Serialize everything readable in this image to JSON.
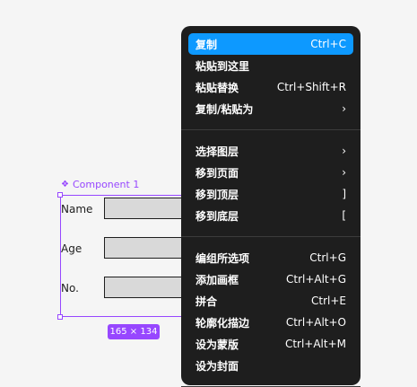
{
  "canvas": {
    "component_label": "Component 1",
    "rows": [
      {
        "label": "Name"
      },
      {
        "label": "Age"
      },
      {
        "label": "No."
      }
    ],
    "size_badge": "165 × 134"
  },
  "context_menu": {
    "groups": [
      [
        {
          "label": "复制",
          "shortcut": "Ctrl+C",
          "active": true
        },
        {
          "label": "粘贴到这里",
          "shortcut": ""
        },
        {
          "label": "粘贴替换",
          "shortcut": "Ctrl+Shift+R"
        },
        {
          "label": "复制/粘贴为",
          "shortcut": "›"
        }
      ],
      [
        {
          "label": "选择图层",
          "shortcut": "›"
        },
        {
          "label": "移到页面",
          "shortcut": "›"
        },
        {
          "label": "移到顶层",
          "shortcut": "]"
        },
        {
          "label": "移到底层",
          "shortcut": "["
        }
      ],
      [
        {
          "label": "编组所选项",
          "shortcut": "Ctrl+G"
        },
        {
          "label": "添加画框",
          "shortcut": "Ctrl+Alt+G"
        },
        {
          "label": "拼合",
          "shortcut": "Ctrl+E"
        },
        {
          "label": "轮廓化描边",
          "shortcut": "Ctrl+Alt+O"
        },
        {
          "label": "设为蒙版",
          "shortcut": "Ctrl+Alt+M"
        },
        {
          "label": "设为封面",
          "shortcut": ""
        }
      ]
    ]
  },
  "colors": {
    "selection": "#9747ff",
    "menu_bg": "#1e1e1e",
    "active_item": "#0d99ff",
    "canvas_bg": "#f5f5f5"
  }
}
